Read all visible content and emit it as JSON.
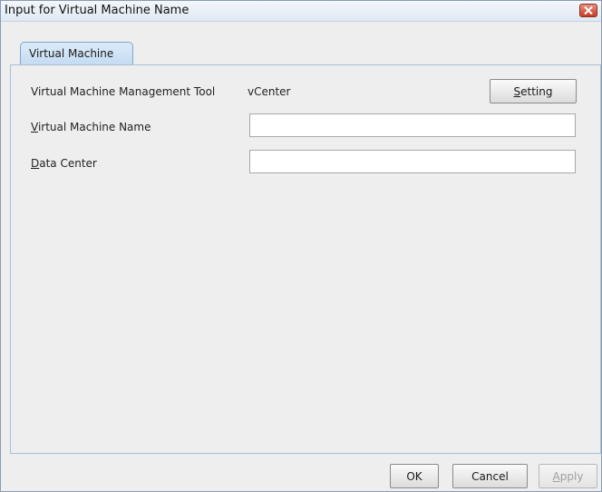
{
  "window": {
    "title": "Input for Virtual Machine Name"
  },
  "tabs": [
    {
      "label": "Virtual Machine",
      "selected": true
    }
  ],
  "form": {
    "management_tool": {
      "label": "Virtual Machine Management Tool",
      "value": "vCenter",
      "setting_button": {
        "mnemonic": "S",
        "rest": "etting"
      }
    },
    "vm_name": {
      "label_mnemonic": "V",
      "label_rest": "irtual Machine Name",
      "value": ""
    },
    "data_center": {
      "label_mnemonic": "D",
      "label_rest": "ata Center",
      "value": ""
    }
  },
  "footer": {
    "ok_label": "OK",
    "cancel_label": "Cancel",
    "apply_mnemonic": "A",
    "apply_rest": "pply",
    "apply_enabled": false
  },
  "colors": {
    "tab_fill": "#c4dbf2",
    "close_button": "#c53c25"
  },
  "icons": {
    "close": "close-x-icon"
  }
}
